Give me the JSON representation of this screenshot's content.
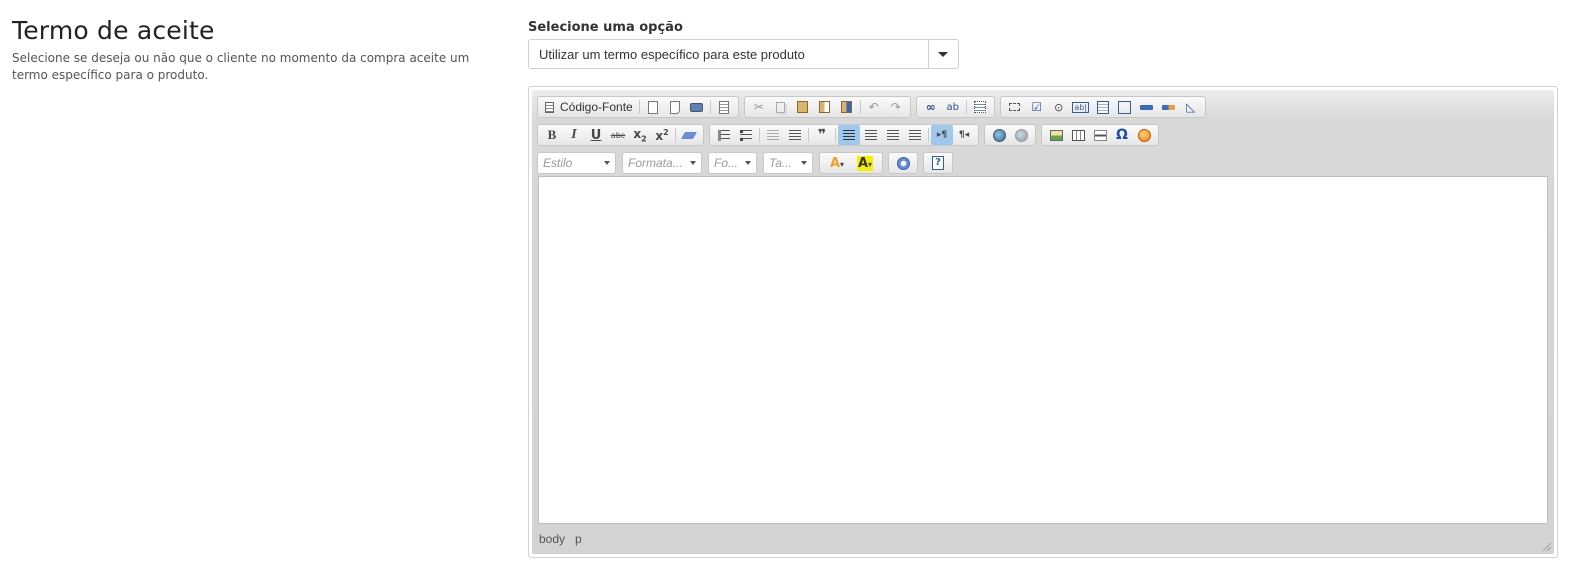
{
  "section": {
    "title": "Termo de aceite",
    "description": "Selecione se deseja ou não que o cliente no momento da compra aceite um termo específico para o produto."
  },
  "option": {
    "label": "Selecione uma opção",
    "selected": "Utilizar um termo específico para este produto"
  },
  "editor": {
    "source_label": "Código-Fonte",
    "combos": {
      "style": "Estilo",
      "format": "Formata...",
      "font": "Fo...",
      "size": "Ta..."
    },
    "path": [
      "body",
      "p"
    ],
    "content": ""
  },
  "icons": {
    "row1": [
      "source-icon",
      "new-page-icon",
      "preview-icon",
      "print-icon",
      "templates-icon",
      "cut-icon",
      "copy-icon",
      "paste-icon",
      "paste-text-icon",
      "paste-word-icon",
      "undo-icon",
      "redo-icon",
      "find-icon",
      "replace-icon",
      "select-all-icon",
      "form-icon",
      "checkbox-icon",
      "radio-icon",
      "textfield-icon",
      "textarea-icon",
      "select-field-icon",
      "button-field-icon",
      "image-button-icon",
      "hidden-field-icon"
    ],
    "row2": [
      "bold-icon",
      "italic-icon",
      "underline-icon",
      "strike-icon",
      "subscript-icon",
      "superscript-icon",
      "remove-format-icon",
      "numbered-list-icon",
      "bulleted-list-icon",
      "outdent-icon",
      "indent-icon",
      "blockquote-icon",
      "align-left-icon",
      "align-center-icon",
      "align-right-icon",
      "justify-icon",
      "ltr-icon",
      "rtl-icon",
      "link-icon",
      "unlink-icon",
      "image-icon",
      "table-icon",
      "horizontal-rule-icon",
      "special-char-icon",
      "smiley-icon"
    ],
    "row3": [
      "text-color-icon",
      "bg-color-icon",
      "maximize-icon",
      "help-icon"
    ]
  },
  "colors": {
    "toolbar_bg": "#d3d3d3",
    "active_button": "#9ec8ee",
    "text_color_accent": "#f0a020",
    "bg_color_accent": "#f5f000"
  }
}
